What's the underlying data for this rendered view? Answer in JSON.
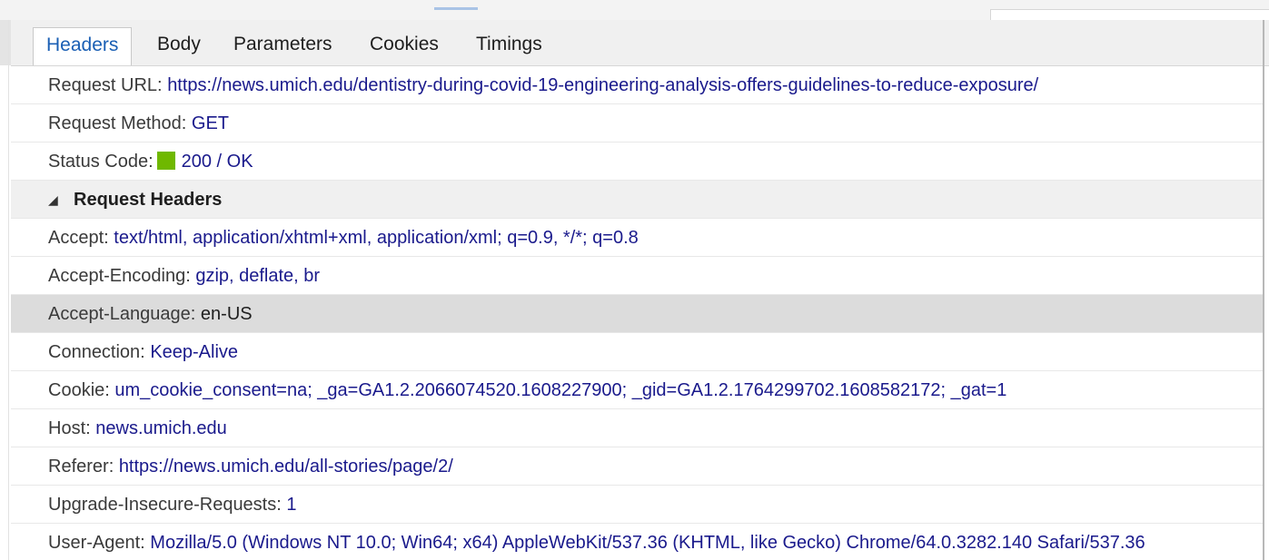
{
  "tabs": [
    {
      "label": "Headers",
      "active": true
    },
    {
      "label": "Body",
      "active": false
    },
    {
      "label": "Parameters",
      "active": false
    },
    {
      "label": "Cookies",
      "active": false
    },
    {
      "label": "Timings",
      "active": false
    }
  ],
  "general": {
    "request_url": {
      "key": "Request URL:",
      "value": "https://news.umich.edu/dentistry-during-covid-19-engineering-analysis-offers-guidelines-to-reduce-exposure/"
    },
    "request_method": {
      "key": "Request Method:",
      "value": "GET"
    },
    "status_code": {
      "key": "Status Code:",
      "value": "200 / OK",
      "color": "#6fb800"
    }
  },
  "request_headers": {
    "title": "Request Headers",
    "collapse_icon": "triangle-down-icon",
    "items": [
      {
        "key": "Accept:",
        "value": "text/html, application/xhtml+xml, application/xml; q=0.9, */*; q=0.8"
      },
      {
        "key": "Accept-Encoding:",
        "value": "gzip, deflate, br"
      },
      {
        "key": "Accept-Language:",
        "value": "en-US"
      },
      {
        "key": "Connection:",
        "value": "Keep-Alive"
      },
      {
        "key": "Cookie:",
        "value": "um_cookie_consent=na; _ga=GA1.2.2066074520.1608227900; _gid=GA1.2.1764299702.1608582172; _gat=1"
      },
      {
        "key": "Host:",
        "value": "news.umich.edu"
      },
      {
        "key": "Referer:",
        "value": "https://news.umich.edu/all-stories/page/2/"
      },
      {
        "key": "Upgrade-Insecure-Requests:",
        "value": "1"
      },
      {
        "key": "User-Agent:",
        "value": "Mozilla/5.0 (Windows NT 10.0; Win64; x64) AppleWebKit/537.36 (KHTML, like Gecko) Chrome/64.0.3282.140 Safari/537.36"
      }
    ]
  },
  "colors": {
    "accent": "#1a5fb4",
    "value_text": "#1a1a8c",
    "status_ok": "#6fb800"
  }
}
